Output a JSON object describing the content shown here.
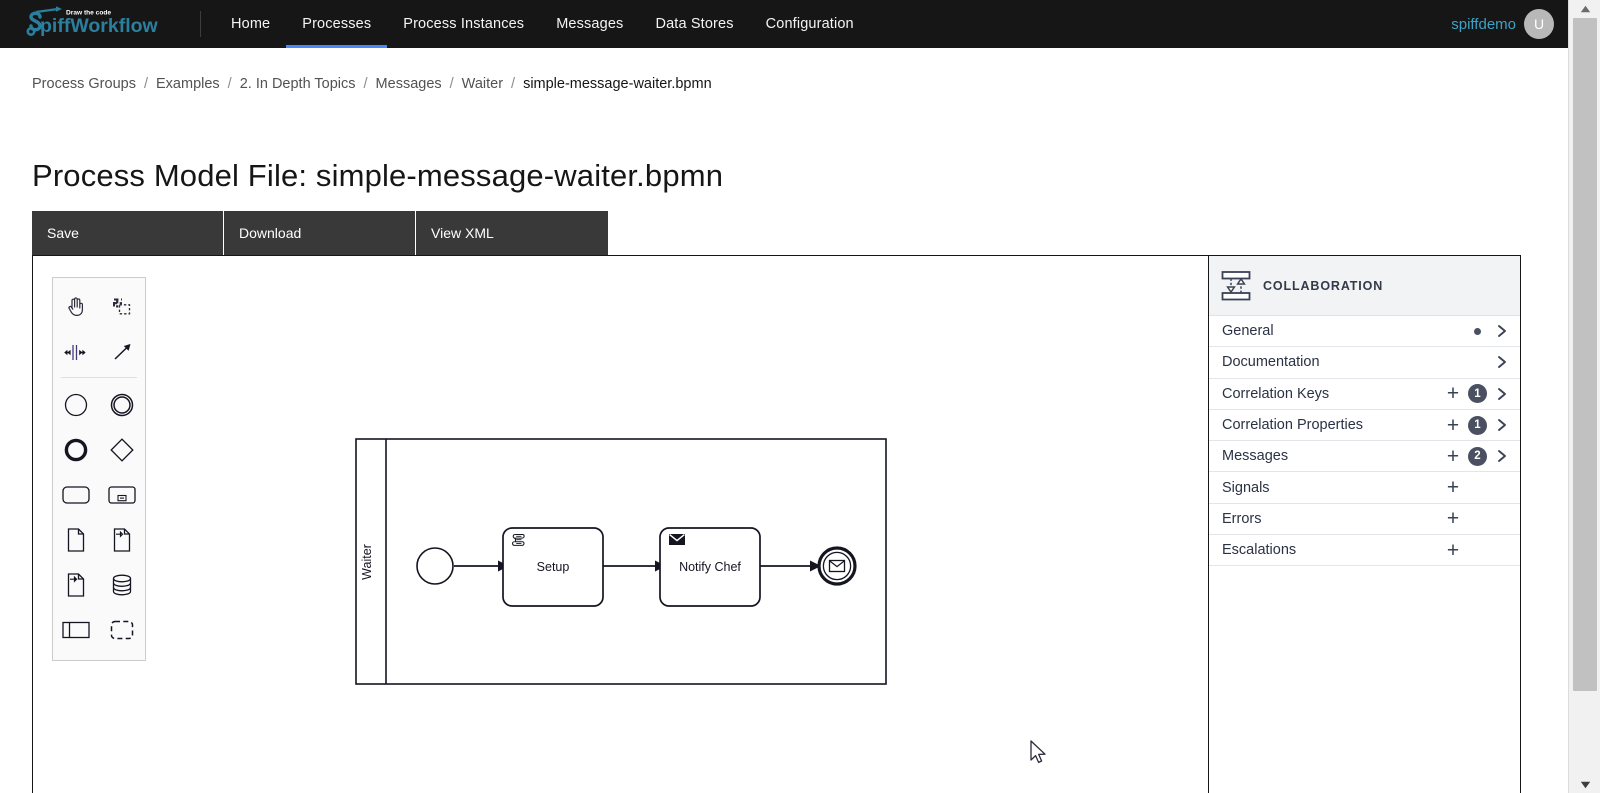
{
  "topnav": {
    "logo_text": "SpiffWorkflow",
    "logo_tagline": "Draw the code",
    "items": [
      {
        "label": "Home",
        "active": false
      },
      {
        "label": "Processes",
        "active": true
      },
      {
        "label": "Process Instances",
        "active": false
      },
      {
        "label": "Messages",
        "active": false
      },
      {
        "label": "Data Stores",
        "active": false
      },
      {
        "label": "Configuration",
        "active": false
      }
    ],
    "user_name": "spiffdemo",
    "avatar_initial": "U",
    "accent_color": "#4589ff",
    "brand_color": "#3ba3c6"
  },
  "breadcrumb": {
    "separator": "/",
    "items": [
      "Process Groups",
      "Examples",
      "2. In Depth Topics",
      "Messages",
      "Waiter",
      "simple-message-waiter.bpmn"
    ]
  },
  "page": {
    "title": "Process Model File: simple-message-waiter.bpmn"
  },
  "toolbar": {
    "buttons": [
      {
        "label": "Save",
        "name": "save-button"
      },
      {
        "label": "Download",
        "name": "download-button"
      },
      {
        "label": "View XML",
        "name": "view-xml-button"
      }
    ]
  },
  "palette": {
    "tools": [
      {
        "name": "hand-tool-icon",
        "label": "Activate the hand tool"
      },
      {
        "name": "lasso-tool-icon",
        "label": "Activate the lasso tool"
      },
      {
        "name": "space-tool-icon",
        "label": "Activate the create/remove space tool"
      },
      {
        "name": "global-connect-tool-icon",
        "label": "Activate the global connect tool"
      }
    ],
    "elements": [
      {
        "name": "start-event-icon",
        "label": "Create StartEvent"
      },
      {
        "name": "intermediate-event-icon",
        "label": "Create Intermediate/Boundary Event"
      },
      {
        "name": "end-event-icon",
        "label": "Create EndEvent"
      },
      {
        "name": "gateway-icon",
        "label": "Create Gateway"
      },
      {
        "name": "task-icon",
        "label": "Create Task"
      },
      {
        "name": "expanded-subprocess-icon",
        "label": "Create expanded SubProcess"
      },
      {
        "name": "data-object-icon",
        "label": "Create DataObjectReference"
      },
      {
        "name": "data-input-icon",
        "label": "Create DataInput"
      },
      {
        "name": "data-output-icon",
        "label": "Create DataOutput"
      },
      {
        "name": "data-store-icon",
        "label": "Create DataStoreReference"
      },
      {
        "name": "participant-icon",
        "label": "Create Pool/Participant"
      },
      {
        "name": "group-icon",
        "label": "Create Group"
      }
    ]
  },
  "diagram": {
    "pool_label": "Waiter",
    "nodes": [
      {
        "id": "start",
        "type": "start-event",
        "label": ""
      },
      {
        "id": "setup",
        "type": "script-task",
        "label": "Setup"
      },
      {
        "id": "notify",
        "type": "send-task",
        "label": "Notify Chef"
      },
      {
        "id": "end",
        "type": "message-end-event",
        "label": ""
      }
    ]
  },
  "properties_panel": {
    "header_title": "COLLABORATION",
    "header_icon": "collaboration-icon",
    "groups": [
      {
        "label": "General",
        "plus": false,
        "badge": null,
        "dot": true,
        "chevron": true
      },
      {
        "label": "Documentation",
        "plus": false,
        "badge": null,
        "dot": false,
        "chevron": true
      },
      {
        "label": "Correlation Keys",
        "plus": true,
        "badge": "1",
        "dot": false,
        "chevron": true
      },
      {
        "label": "Correlation Properties",
        "plus": true,
        "badge": "1",
        "dot": false,
        "chevron": true
      },
      {
        "label": "Messages",
        "plus": true,
        "badge": "2",
        "dot": false,
        "chevron": true
      },
      {
        "label": "Signals",
        "plus": true,
        "badge": null,
        "dot": false,
        "chevron": false
      },
      {
        "label": "Errors",
        "plus": true,
        "badge": null,
        "dot": false,
        "chevron": false
      },
      {
        "label": "Escalations",
        "plus": true,
        "badge": null,
        "dot": false,
        "chevron": false
      }
    ],
    "plus_glyph": "+",
    "badge_color": "#4a5061"
  },
  "scrollbar": {
    "up_arrow": "▲",
    "down_arrow": "▼"
  }
}
